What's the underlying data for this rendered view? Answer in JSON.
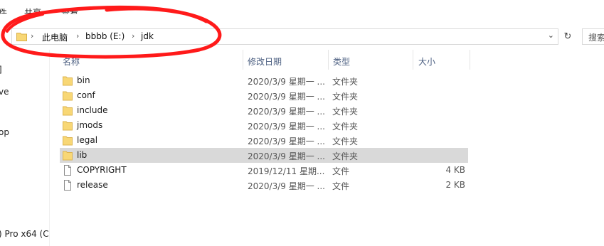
{
  "ribbon": {
    "tabs": [
      "件",
      "共享",
      "查看"
    ]
  },
  "address": {
    "crumbs": [
      "此电脑",
      "bbbb (E:)",
      "jdk"
    ],
    "search_placeholder": "搜索"
  },
  "nav": {
    "items": [
      "]",
      "ve",
      "op",
      ") Pro x64 (C"
    ]
  },
  "columns": {
    "name": "名称",
    "date": "修改日期",
    "type": "类型",
    "size": "大小"
  },
  "files": [
    {
      "name": "bin",
      "date": "2020/3/9 星期一 ...",
      "type": "文件夹",
      "size": "",
      "kind": "folder"
    },
    {
      "name": "conf",
      "date": "2020/3/9 星期一 ...",
      "type": "文件夹",
      "size": "",
      "kind": "folder"
    },
    {
      "name": "include",
      "date": "2020/3/9 星期一 ...",
      "type": "文件夹",
      "size": "",
      "kind": "folder"
    },
    {
      "name": "jmods",
      "date": "2020/3/9 星期一 ...",
      "type": "文件夹",
      "size": "",
      "kind": "folder"
    },
    {
      "name": "legal",
      "date": "2020/3/9 星期一 ...",
      "type": "文件夹",
      "size": "",
      "kind": "folder"
    },
    {
      "name": "lib",
      "date": "2020/3/9 星期一 ...",
      "type": "文件夹",
      "size": "",
      "kind": "folder",
      "selected": true
    },
    {
      "name": "COPYRIGHT",
      "date": "2019/12/11 星期...",
      "type": "文件",
      "size": "4 KB",
      "kind": "file"
    },
    {
      "name": "release",
      "date": "2020/3/9 星期一 ...",
      "type": "文件",
      "size": "2 KB",
      "kind": "file"
    }
  ],
  "colors": {
    "annotation": "#ff1a1a",
    "folder": "#f8d775",
    "selection": "#d9d9d9"
  }
}
